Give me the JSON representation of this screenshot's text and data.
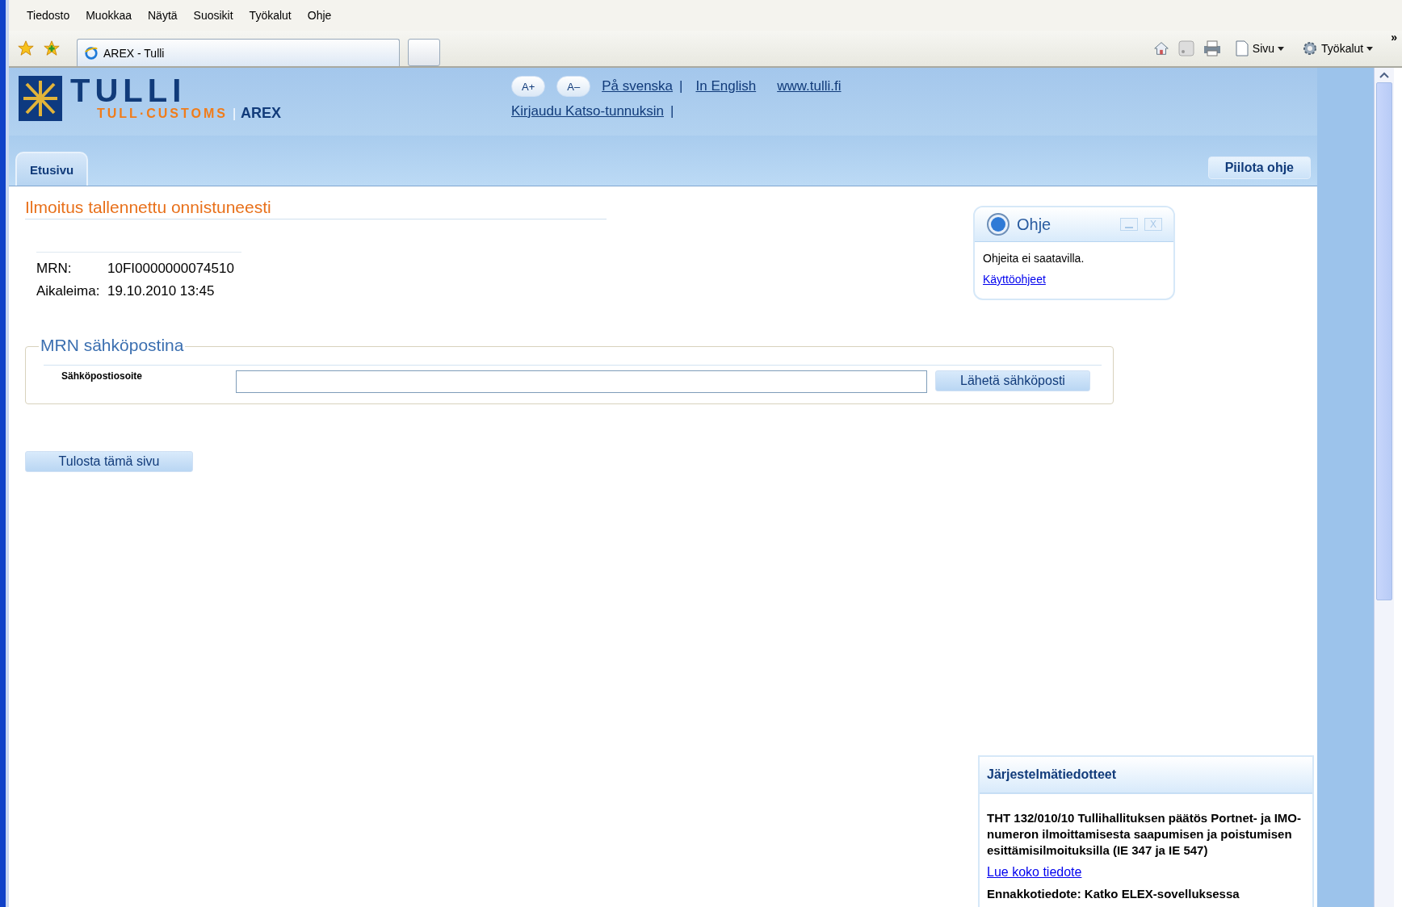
{
  "menu": [
    "Tiedosto",
    "Muokkaa",
    "Näytä",
    "Suosikit",
    "Työkalut",
    "Ohje"
  ],
  "browser_tab": {
    "title": "AREX - Tulli"
  },
  "toolbar": {
    "page_menu": "Sivu",
    "tools_menu": "Työkalut",
    "more": "»"
  },
  "header": {
    "logo": {
      "title": "TULLI",
      "subtitle": "TULL·CUSTOMS",
      "separator": "|",
      "app": "AREX"
    },
    "font_buttons": [
      "A+",
      "A–"
    ],
    "links": [
      {
        "label": "På svenska",
        "separator": "|"
      },
      {
        "label": "In English"
      },
      {
        "label": "www.tulli.fi"
      }
    ],
    "login": {
      "label": "Kirjaudu Katso-tunnuksin",
      "separator": "|"
    }
  },
  "nav_tabs": [
    {
      "label": "Etusivu",
      "selected": true
    }
  ],
  "hide_help_button": "Piilota ohje",
  "notice": {
    "title": "Ilmoitus tallennettu onnistuneesti",
    "fields": [
      {
        "label": "MRN:",
        "value": "10FI0000000074510"
      },
      {
        "label": "Aikaleima:",
        "value": "19.10.2010 13:45"
      }
    ]
  },
  "email_section": {
    "legend": "MRN sähköpostina",
    "field_label": "Sähköpostiosoite",
    "button": "Lähetä sähköposti"
  },
  "print_button": "Tulosta tämä sivu",
  "help_panel": {
    "title": "Ohje",
    "close": "X",
    "text": "Ohjeita ei saatavilla.",
    "link": "Käyttöohjeet"
  },
  "system_notices": {
    "title": "Järjestelmätiedotteet",
    "items": [
      {
        "kind": "notice",
        "text": "THT 132/010/10 Tullihallituksen päätös Portnet- ja IMO-numeron ilmoittamisesta saapumisen ja poistumisen esittämisilmoituksilla (IE 347 ja IE 547)"
      },
      {
        "kind": "link",
        "text": "Lue koko tiedote"
      },
      {
        "kind": "notice",
        "text": "Ennakkotiedote: Katko ELEX-sovelluksessa"
      }
    ]
  }
}
